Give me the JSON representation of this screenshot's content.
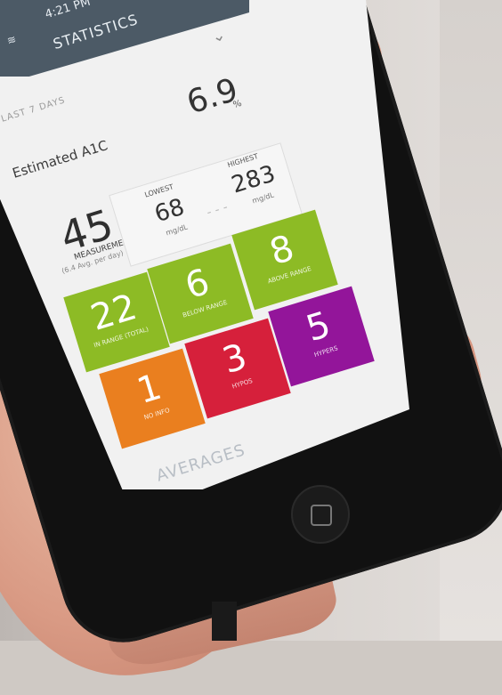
{
  "status": {
    "time": "4:21 PM"
  },
  "header": {
    "title": "STATISTICS"
  },
  "range_label": "LAST 7 DAYS",
  "a1c": {
    "label": "Estimated A1C",
    "value": "6.9",
    "unit": "%"
  },
  "measurements": {
    "count": "45",
    "label": "MEASUREMENTS",
    "sub": "(6.4 Avg. per day)"
  },
  "lowest": {
    "heading": "LOWEST",
    "value": "68",
    "unit": "mg/dL"
  },
  "highest": {
    "heading": "HIGHEST",
    "value": "283",
    "unit": "mg/dL"
  },
  "tiles": [
    {
      "value": "8",
      "label": "ABOVE RANGE",
      "color": "#8dbb25"
    },
    {
      "value": "6",
      "label": "BELOW RANGE",
      "color": "#8dbb25"
    },
    {
      "value": "22",
      "label": "IN RANGE (TOTAL)",
      "color": "#8dbb25"
    },
    {
      "value": "5",
      "label": "HYPERS",
      "color": "#93159a"
    },
    {
      "value": "3",
      "label": "HYPOS",
      "color": "#d6203b"
    },
    {
      "value": "1",
      "label": "NO INFO",
      "color": "#ea7f1f"
    }
  ],
  "section_averages": "AVERAGES"
}
